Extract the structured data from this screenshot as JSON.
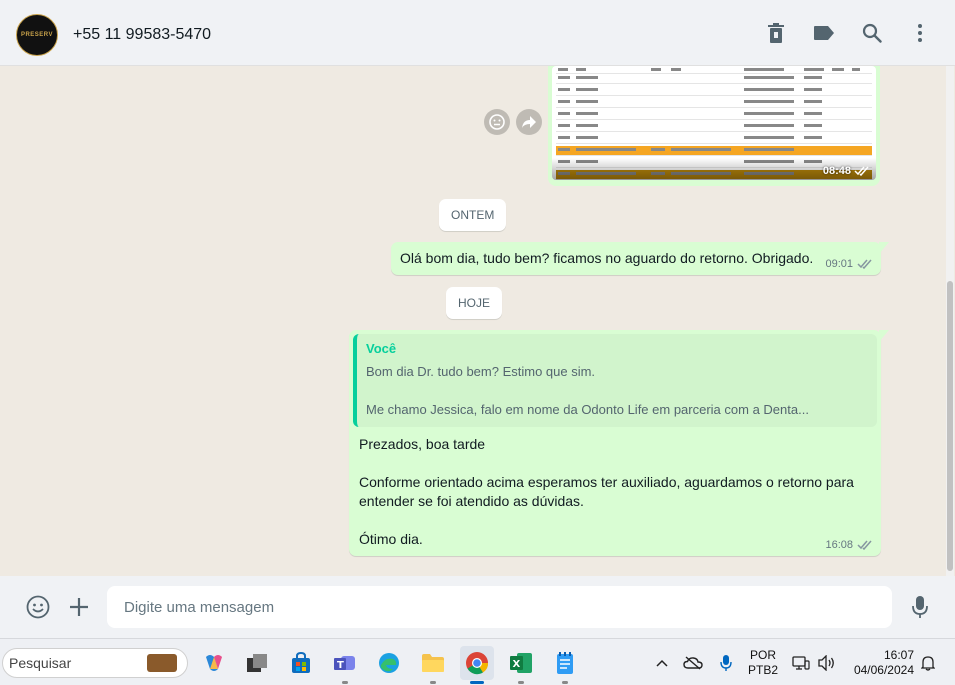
{
  "header": {
    "contact_name": "+55 11 99583-5470",
    "avatar_text": "PRESERV"
  },
  "image_message": {
    "time": "08:48"
  },
  "chips": {
    "yesterday": "ONTEM",
    "today": "HOJE"
  },
  "messages": [
    {
      "text": "Olá bom dia, tudo bem? ficamos no aguardo do retorno. Obrigado.",
      "time": "09:01"
    },
    {
      "quote_author": "Você",
      "quote_text": "Bom dia Dr. tudo bem? Estimo que sim.\n\nMe chamo Jessica, falo em nome da Odonto Life em parceria com a Denta...",
      "text": "Prezados, boa tarde\n\nConforme orientado acima esperamos ter auxiliado, aguardamos o retorno para entender se foi atendido as dúvidas.\n\nÓtimo dia.",
      "time": "16:08"
    }
  ],
  "composer": {
    "placeholder": "Digite uma mensagem"
  },
  "taskbar": {
    "search_label": "Pesquisar",
    "lang_line1": "POR",
    "lang_line2": "PTB2",
    "time": "16:07",
    "date": "04/06/2024"
  },
  "colors": {
    "outgoing_bubble": "#d9fdd3",
    "chat_background": "#efeae2",
    "quote_accent": "#06cf9c",
    "read_tick": "#8696a0"
  }
}
